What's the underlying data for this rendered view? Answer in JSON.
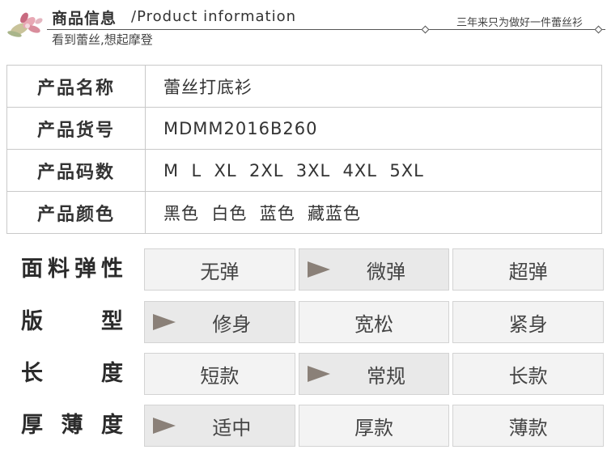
{
  "header": {
    "title_cn": "商品信息",
    "title_en": "/Product information",
    "subtitle": "看到蕾丝,想起摩登",
    "slogan": "三年来只为做好一件蕾丝衫",
    "icon": "flower-icon"
  },
  "info": [
    {
      "label": "产品名称",
      "value": "蕾丝打底衫"
    },
    {
      "label": "产品货号",
      "value": "MDMM2016B260"
    },
    {
      "label": "产品码数",
      "value": "M  L  XL  2XL  3XL  4XL  5XL"
    },
    {
      "label": "产品颜色",
      "value": "黑色  白色  蓝色  藏蓝色"
    }
  ],
  "attributes": [
    {
      "label_chars": [
        "面",
        "料",
        "弹",
        "性"
      ],
      "options": [
        "无弹",
        "微弹",
        "超弹"
      ],
      "selected": 1
    },
    {
      "label_chars": [
        "版",
        "型"
      ],
      "options": [
        "修身",
        "宽松",
        "紧身"
      ],
      "selected": 0
    },
    {
      "label_chars": [
        "长",
        "度"
      ],
      "options": [
        "短款",
        "常规",
        "长款"
      ],
      "selected": 1
    },
    {
      "label_chars": [
        "厚",
        "薄",
        "度"
      ],
      "options": [
        "适中",
        "厚款",
        "薄款"
      ],
      "selected": 0
    }
  ],
  "colors": {
    "arrow": "#8a8078",
    "border": "#c9c9c9"
  }
}
